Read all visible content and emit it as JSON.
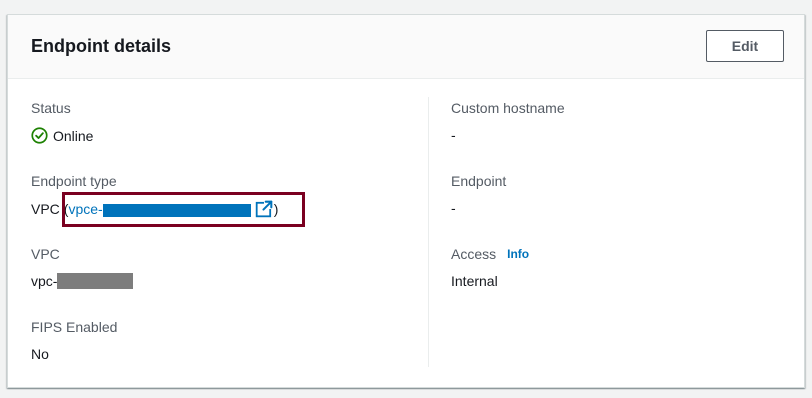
{
  "panel": {
    "title": "Endpoint details",
    "edit_label": "Edit"
  },
  "left": {
    "status": {
      "label": "Status",
      "value": "Online",
      "icon": "check-circle-icon"
    },
    "endpoint_type": {
      "label": "Endpoint type",
      "prefix": "VPC",
      "open_paren": "(",
      "link_text": "vpce-",
      "close_paren": ")",
      "icon": "external-link-icon"
    },
    "vpc": {
      "label": "VPC",
      "value": "vpc-"
    },
    "fips": {
      "label": "FIPS Enabled",
      "value": "No"
    }
  },
  "right": {
    "custom_hostname": {
      "label": "Custom hostname",
      "value": "-"
    },
    "endpoint": {
      "label": "Endpoint",
      "value": "-"
    },
    "access": {
      "label": "Access",
      "info_label": "Info",
      "value": "Internal"
    }
  },
  "colors": {
    "link": "#0073bb",
    "success": "#1d8102",
    "highlight_border": "#7a0020"
  }
}
